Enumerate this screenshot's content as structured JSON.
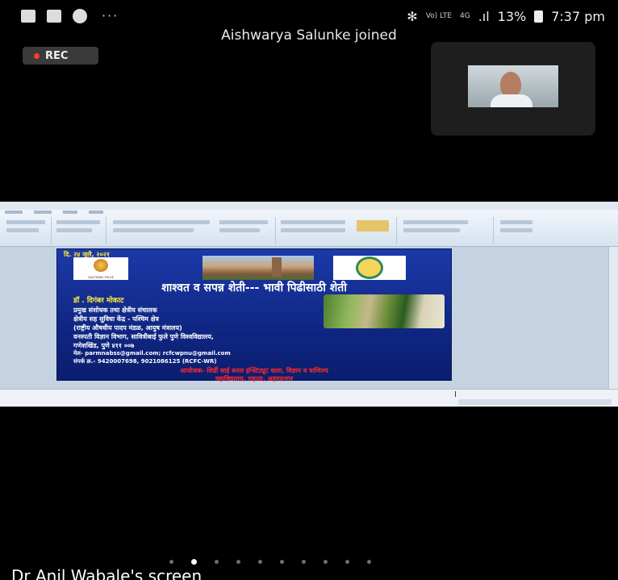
{
  "status_bar": {
    "network": "Vo) LTE",
    "network_2": "4G",
    "signal": ".ıl",
    "battery_percent": "13%",
    "time": "7:37 pm",
    "more": "···"
  },
  "toast": "Aishwarya Salunke joined",
  "rec_label": "REC",
  "slide": {
    "date": "दि. २४ जुलै, २०२१",
    "title": "शाश्वत व सपन्न शेती--- भावी पिढीसाठी शेती",
    "speaker": "डॉ . दिगंबर मोकाट",
    "lines": [
      "प्रमुख संशोधक तथा क्षेत्रीय संचालक",
      "क्षेत्रीय सह सुविधा केंद्र - पश्चिम क्षेत्र",
      "(राष्ट्रीय औषधीय पादप मंडळ, आयुष मंत्रालय)",
      "वनस्पती विज्ञान विभाग, सावित्रीबाई फुले पुणे विश्वविद्यालय,",
      "गणेशखिंड, पुणे ४११ ००७"
    ],
    "email": "मेल- parmnabss@gmail.com;   rcfcwpnu@gmail.com",
    "phone": "संपर्क क्र.- 9420007698, 9021086125 (RCFC-WR)",
    "organizer_1": "आयोजक- शिर्डी साई रूरल इन्स्टिट्यूट कला, विज्ञान व वाणिज्य",
    "organizer_2": "महाविद्यालय, राहाता, अहमदनगर"
  },
  "screen_owner": "Dr Anil Wabale's screen",
  "page_indicator": {
    "count": 10,
    "active": 1
  }
}
